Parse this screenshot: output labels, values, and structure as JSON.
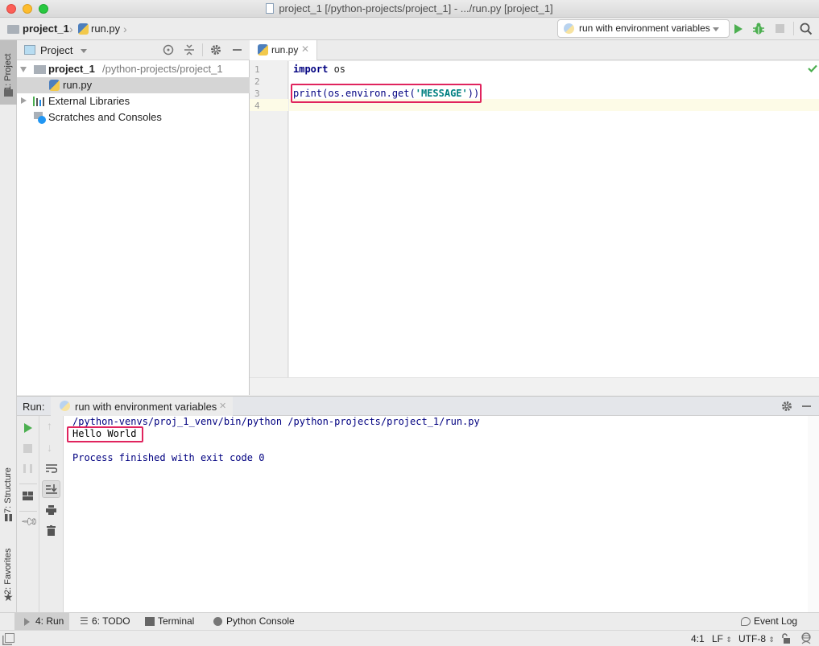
{
  "window": {
    "title": "project_1 [/python-projects/project_1] - .../run.py [project_1]"
  },
  "navbar": {
    "breadcrumbs": [
      {
        "label": "project_1",
        "icon": "folder-icon"
      },
      {
        "label": "run.py",
        "icon": "python-file-icon"
      }
    ],
    "run_config": {
      "label": "run with environment variables",
      "icon": "python-icon"
    },
    "actions": [
      "run-icon",
      "debug-icon",
      "stop-icon",
      "search-icon"
    ]
  },
  "left_strip": {
    "tabs": [
      {
        "label": "1: Project"
      },
      {
        "label": "7: Structure"
      },
      {
        "label": "2: Favorites"
      }
    ]
  },
  "project_panel": {
    "view_selector": "Project",
    "tree": [
      {
        "label": "project_1",
        "path": "/python-projects/project_1",
        "expanded": true,
        "icon": "folder-icon"
      },
      {
        "label": "run.py",
        "selected": true,
        "icon": "python-file-icon"
      },
      {
        "label": "External Libraries",
        "expanded": false,
        "icon": "libraries-icon"
      },
      {
        "label": "Scratches and Consoles",
        "icon": "scratches-icon"
      }
    ]
  },
  "editor": {
    "tabs": [
      {
        "label": "run.py",
        "active": true
      }
    ],
    "line_numbers": [
      "1",
      "2",
      "3",
      "4"
    ],
    "code": {
      "line1_keyword": "import",
      "line1_rest": " os",
      "line3_prefix": "print(os.environ.get(",
      "line3_string": "'MESSAGE'",
      "line3_suffix": "))"
    },
    "inspection_status": "ok",
    "current_line": 4
  },
  "run_panel": {
    "label": "Run:",
    "tab_label": "run with environment variables",
    "console": [
      "/python-venvs/proj_1_venv/bin/python /python-projects/project_1/run.py",
      "Hello World",
      "",
      "Process finished with exit code 0"
    ]
  },
  "tool_windows": [
    {
      "label": "4: Run",
      "active": true,
      "icon": "run-icon"
    },
    {
      "label": "6: TODO",
      "icon": "list-icon"
    },
    {
      "label": "Terminal",
      "icon": "terminal-icon"
    },
    {
      "label": "Python Console",
      "icon": "python-icon"
    }
  ],
  "event_log": {
    "label": "Event Log"
  },
  "status_bar": {
    "position": "4:1",
    "line_separator": "LF",
    "encoding": "UTF-8"
  },
  "colors": {
    "highlight_box": "#e0245e",
    "keyword": "#000080",
    "string": "#008080",
    "run_green": "#4caf50"
  }
}
